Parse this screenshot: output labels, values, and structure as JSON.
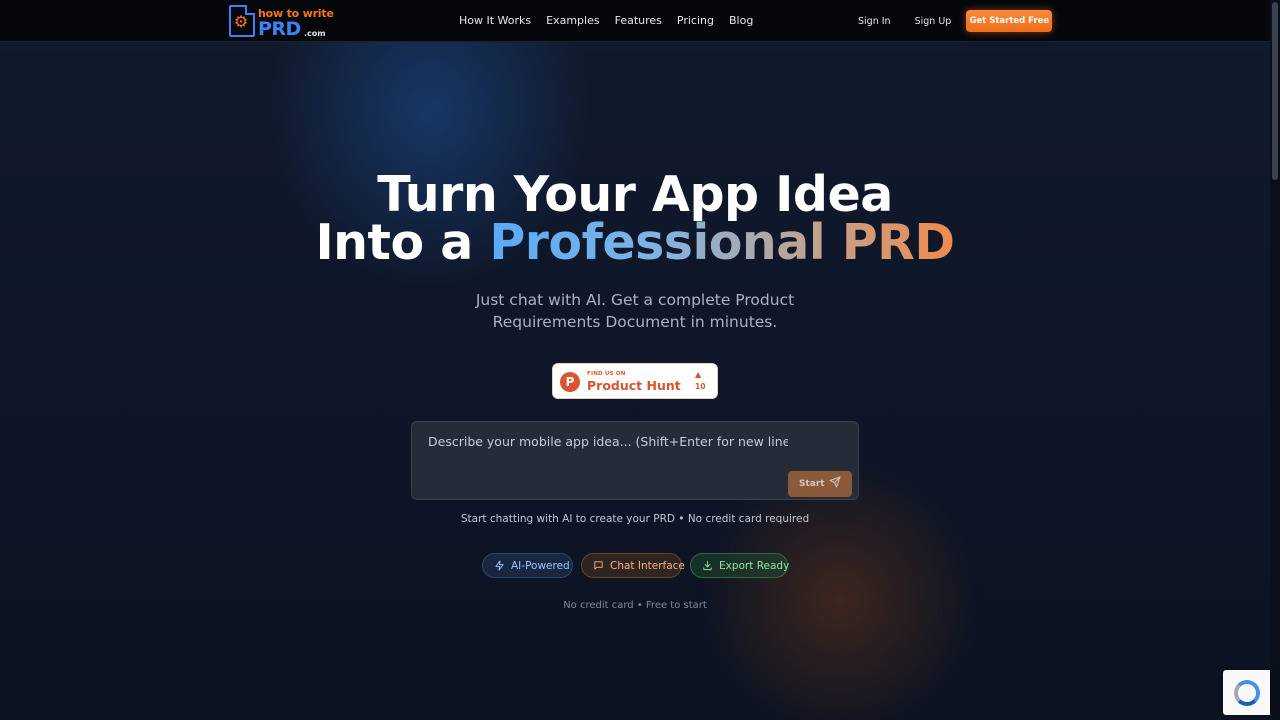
{
  "nav": {
    "logo": {
      "line1": "how to write",
      "line2": "PRD",
      "suffix": ".com"
    },
    "links": [
      "How It Works",
      "Examples",
      "Features",
      "Pricing",
      "Blog"
    ],
    "sign_in": "Sign In",
    "sign_up": "Sign Up",
    "cta": "Get Started Free"
  },
  "hero": {
    "line1": "Turn Your App Idea",
    "line2_prefix": "Into a ",
    "line2_highlight": "Professional PRD",
    "subtitle": "Just chat with AI. Get a complete Product Requirements Document in minutes."
  },
  "product_hunt": {
    "find_us": "FIND US ON",
    "name": "Product Hunt",
    "arrow": "▲",
    "count": "10"
  },
  "chat": {
    "placeholder": "Describe your mobile app idea... (Shift+Enter for new line)",
    "start_label": "Start",
    "caption": "Start chatting with AI to create your PRD • No credit card required"
  },
  "pills": {
    "ai": "AI-Powered",
    "chat": "Chat Interface",
    "export": "Export Ready"
  },
  "footnote": "No credit card • Free to start",
  "colors": {
    "accent_orange": "#f97316",
    "accent_blue": "#3b82f6",
    "background": "#0e1525"
  }
}
